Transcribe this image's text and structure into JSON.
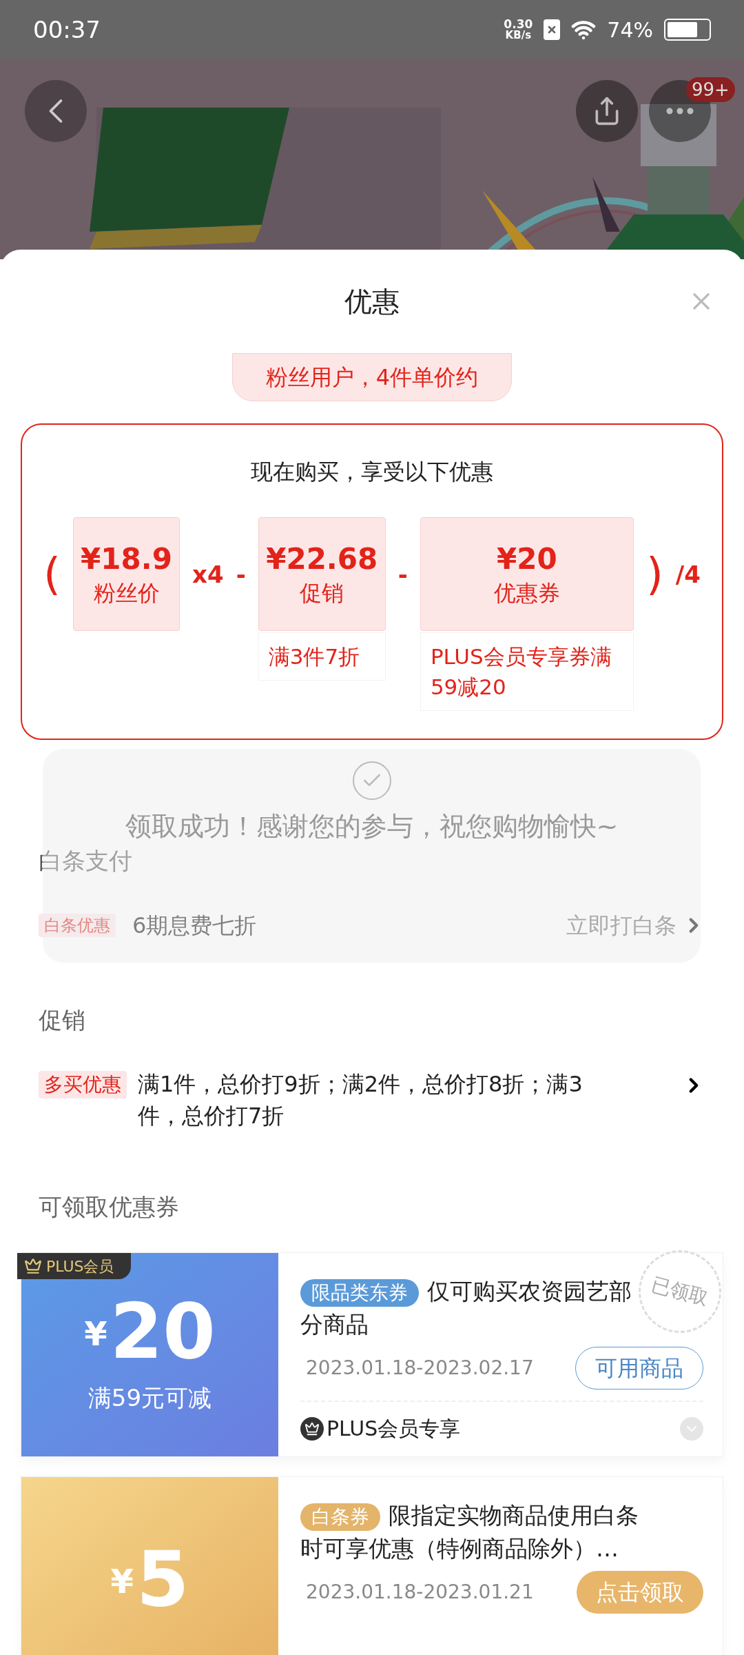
{
  "status_bar": {
    "time": "00:37",
    "net_speed": "0.30",
    "net_unit": "KB/s",
    "battery": "74%"
  },
  "header": {
    "more_badge": "99+"
  },
  "sheet": {
    "title": "优惠"
  },
  "price_tip": "粉丝用户，4件单价约",
  "breakdown": {
    "heading": "现在购买，享受以下优惠",
    "formula": [
      {
        "kind": "paren",
        "text": "("
      },
      {
        "kind": "term",
        "amount": "¥18.9",
        "label": "粉丝价"
      },
      {
        "kind": "op",
        "text": "x4"
      },
      {
        "kind": "op",
        "text": "-"
      },
      {
        "kind": "term",
        "amount": "¥22.68",
        "label": "促销",
        "note": "满3件7折"
      },
      {
        "kind": "op",
        "text": "-"
      },
      {
        "kind": "term",
        "amount": "¥20",
        "label": "优惠券",
        "note": "PLUS会员专享券满59减20",
        "wide": true
      },
      {
        "kind": "paren",
        "text": ")"
      },
      {
        "kind": "op",
        "text": "/4"
      }
    ]
  },
  "baitiao": {
    "title": "白条支付",
    "tag": "白条优惠",
    "text": "6期息费七折",
    "action": "立即打白条"
  },
  "promotion": {
    "title": "促销",
    "tag": "多买优惠",
    "text": "满1件，总价打9折；满2件，总价打8折；满3件，总价打7折"
  },
  "coupons_title": "可领取优惠券",
  "coupons": [
    {
      "kind": "plus",
      "member_badge": "PLUS会员",
      "currency": "¥",
      "amount": "20",
      "condition": "满59元可减",
      "tag": "限品类东券",
      "desc": "仅可购买农资园艺部分商品",
      "dates": "2023.01.18-2023.02.17",
      "button": "可用商品",
      "footer": "PLUS会员专享",
      "stamp": "已领取"
    },
    {
      "kind": "baitiao",
      "currency": "¥",
      "amount": "5",
      "tag": "白条券",
      "desc": "限指定实物商品使用白条时可享优惠（特例商品除外）…",
      "dates": "2023.01.18-2023.01.21",
      "button": "点击领取"
    }
  ],
  "toast": "领取成功！感谢您的参与，祝您购物愉快~"
}
